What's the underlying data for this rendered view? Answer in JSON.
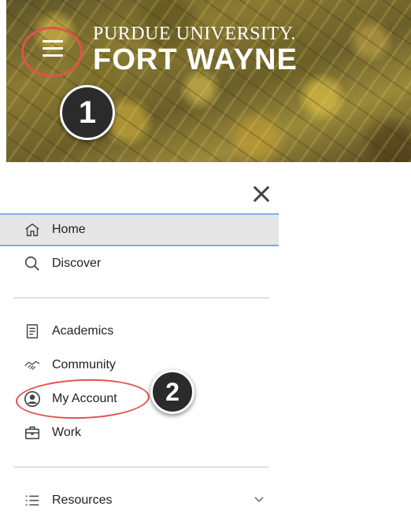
{
  "banner": {
    "logo_line1": "PURDUE UNIVERSITY.",
    "logo_line2": "FORT WAYNE"
  },
  "annotations": {
    "step1": "1",
    "step2": "2",
    "ring_color": "#e0524e"
  },
  "nav": {
    "items": [
      {
        "label": "Home",
        "icon": "home-icon",
        "active": true
      },
      {
        "label": "Discover",
        "icon": "search-icon"
      },
      {
        "label": "Academics",
        "icon": "document-icon"
      },
      {
        "label": "Community",
        "icon": "handshake-icon"
      },
      {
        "label": "My Account",
        "icon": "user-circle-icon"
      },
      {
        "label": "Work",
        "icon": "briefcase-icon"
      },
      {
        "label": "Resources",
        "icon": "list-icon",
        "expandable": true
      }
    ],
    "active_border_color": "#7aaee8",
    "active_bg_color": "#e6e6e6"
  }
}
